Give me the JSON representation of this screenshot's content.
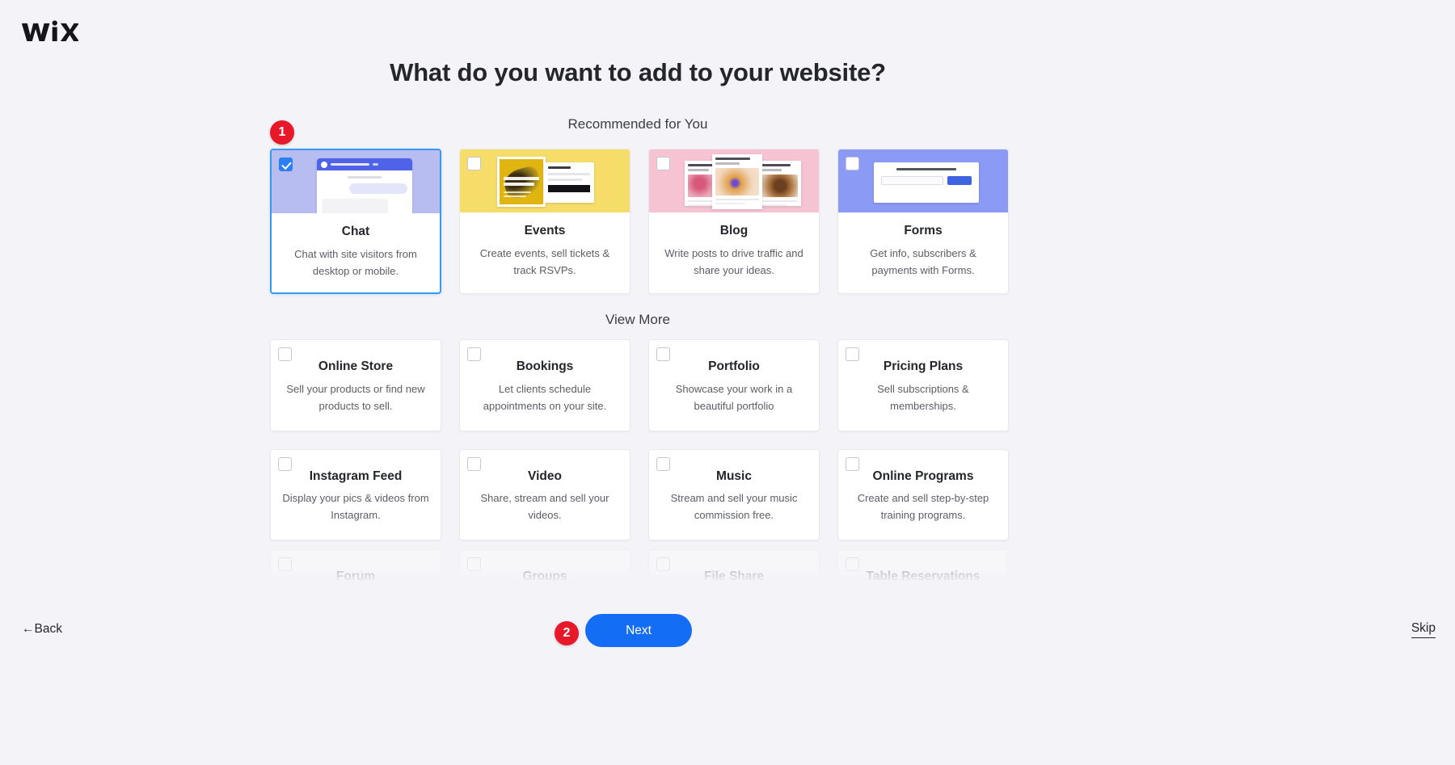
{
  "brand": {
    "logo_text": "WiX",
    "accent": "#136df5",
    "annotation_color": "#e8182b",
    "background": "#f4f4f8"
  },
  "header": {
    "title": "What do you want to add to your website?"
  },
  "sections": {
    "recommended_label": "Recommended for You",
    "view_more_label": "View More"
  },
  "recommended_cards": [
    {
      "title": "Chat",
      "desc": "Chat with site visitors from desktop or mobile.",
      "selected": true,
      "thumb_color": "#b7bdf0",
      "thumb_name": "chat-preview-thumbnail"
    },
    {
      "title": "Events",
      "desc": "Create events, sell tickets & track RSVPs.",
      "selected": false,
      "thumb_color": "#f6dd6a",
      "thumb_name": "events-preview-thumbnail"
    },
    {
      "title": "Blog",
      "desc": "Write posts to drive traffic and share your ideas.",
      "selected": false,
      "thumb_color": "#f5c3d2",
      "thumb_name": "blog-preview-thumbnail"
    },
    {
      "title": "Forms",
      "desc": "Get info, subscribers & payments with Forms.",
      "selected": false,
      "thumb_color": "#8b9bf5",
      "thumb_name": "forms-preview-thumbnail"
    }
  ],
  "more_cards": [
    {
      "title": "Online Store",
      "desc": "Sell your products or find new products to sell.",
      "selected": false
    },
    {
      "title": "Bookings",
      "desc": "Let clients schedule appointments on your site.",
      "selected": false
    },
    {
      "title": "Portfolio",
      "desc": "Showcase your work in a beautiful portfolio",
      "selected": false
    },
    {
      "title": "Pricing Plans",
      "desc": "Sell subscriptions & memberships.",
      "selected": false
    },
    {
      "title": "Instagram Feed",
      "desc": "Display your pics & videos from Instagram.",
      "selected": false
    },
    {
      "title": "Video",
      "desc": "Share, stream and sell your videos.",
      "selected": false
    },
    {
      "title": "Music",
      "desc": "Stream and sell your music commission free.",
      "selected": false
    },
    {
      "title": "Online Programs",
      "desc": "Create and sell step-by-step training programs.",
      "selected": false
    }
  ],
  "cut_off_cards": [
    {
      "title": "Forum",
      "selected": false
    },
    {
      "title": "Groups",
      "selected": false
    },
    {
      "title": "File Share",
      "selected": false
    },
    {
      "title": "Table Reservations",
      "selected": false
    }
  ],
  "annotations": [
    {
      "number": "1",
      "target": "chat-card"
    },
    {
      "number": "2",
      "target": "next-button"
    }
  ],
  "footer": {
    "back_label": "←Back",
    "next_label": "Next",
    "skip_label": "Skip"
  }
}
